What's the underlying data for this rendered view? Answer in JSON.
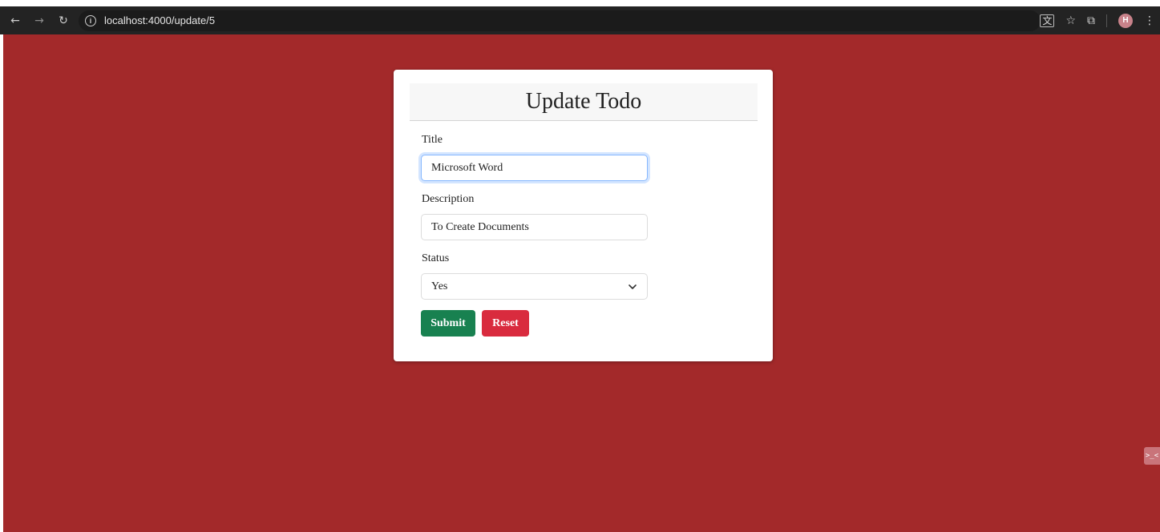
{
  "browser": {
    "url": "localhost:4000/update/5",
    "profile_initial": "H",
    "icons": {
      "back": "back-arrow-icon",
      "forward": "forward-arrow-icon",
      "reload": "reload-icon",
      "info": "info-icon",
      "translate": "translate-icon",
      "bookmark": "star-icon",
      "extensions": "puzzle-icon",
      "menu": "kebab-menu-icon"
    }
  },
  "colors": {
    "page_background": "#a3292a",
    "submit": "#188150",
    "reset": "#d92b3e",
    "focus_ring": "#86b7fe"
  },
  "form": {
    "heading": "Update Todo",
    "title_label": "Title",
    "title_value": "Microsoft Word",
    "description_label": "Description",
    "description_value": "To Create Documents",
    "status_label": "Status",
    "status_value": "Yes",
    "submit_label": "Submit",
    "reset_label": "Reset"
  },
  "devtools_tab": {
    "label": ">_<"
  }
}
